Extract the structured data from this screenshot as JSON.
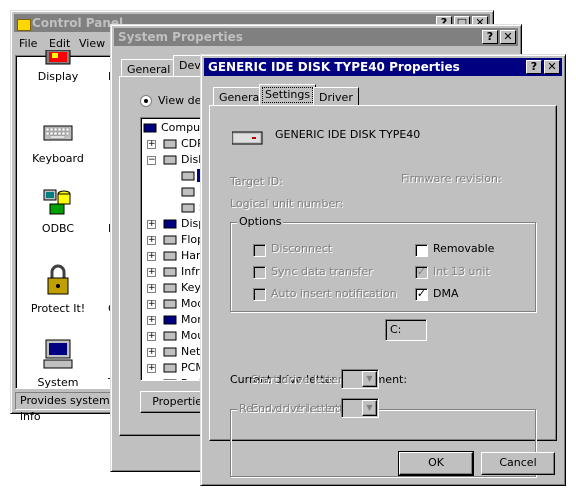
{
  "control_panel": {
    "title": "Control Panel",
    "menu": [
      "File",
      "Edit",
      "View"
    ],
    "icons": [
      {
        "label": "Display",
        "icon": "display-icon"
      },
      {
        "label": "Keyboard",
        "icon": "keyboard-icon"
      },
      {
        "label": "ODBC",
        "icon": "odbc-icon"
      },
      {
        "label": "Protect It!",
        "icon": "protect-it-icon"
      },
      {
        "label": "System",
        "icon": "system-icon"
      }
    ],
    "partial_column": [
      "I",
      "F",
      "C",
      "T"
    ],
    "status": "Provides system info"
  },
  "system_properties": {
    "title": "System Properties",
    "tabs": [
      "General",
      "Devi"
    ],
    "radio_label": "View dev",
    "tree": [
      {
        "label": "Compute",
        "expand": "",
        "icon": "computer-icon"
      },
      {
        "label": "CDR",
        "expand": "+",
        "icon": "cdrom-icon"
      },
      {
        "label": "Disk",
        "expand": "−",
        "icon": "disk-drive-icon"
      },
      {
        "label": "",
        "expand": "",
        "icon": "disk-drive-icon",
        "selected": true
      },
      {
        "label": "I",
        "expand": "",
        "icon": "disk-drive-icon"
      },
      {
        "label": "S",
        "expand": "",
        "icon": "disk-drive-icon"
      },
      {
        "label": "Disp",
        "expand": "+",
        "icon": "display-adapter-icon"
      },
      {
        "label": "Flop",
        "expand": "+",
        "icon": "floppy-icon"
      },
      {
        "label": "Hard",
        "expand": "+",
        "icon": "hard-disk-controller-icon"
      },
      {
        "label": "Infra",
        "expand": "+",
        "icon": "infrared-icon"
      },
      {
        "label": "Keyb",
        "expand": "+",
        "icon": "keyboard-icon"
      },
      {
        "label": "Mod",
        "expand": "+",
        "icon": "modem-icon"
      },
      {
        "label": "Mon",
        "expand": "+",
        "icon": "monitor-icon"
      },
      {
        "label": "Mou",
        "expand": "+",
        "icon": "mouse-icon"
      },
      {
        "label": "Netv",
        "expand": "+",
        "icon": "network-icon"
      },
      {
        "label": "PCM",
        "expand": "+",
        "icon": "pcmcia-icon"
      },
      {
        "label": "Port",
        "expand": "+",
        "icon": "port-icon"
      }
    ],
    "properties_button": "Properties"
  },
  "disk_dialog": {
    "title": "GENERIC IDE  DISK TYPE40 Properties",
    "tabs": [
      "General",
      "Settings",
      "Driver"
    ],
    "active_tab": "Settings",
    "device_name": "GENERIC IDE  DISK TYPE40",
    "target_id_label": "Target ID:",
    "firmware_label": "Firmware revision:",
    "lun_label": "Logical unit number:",
    "options_label": "Options",
    "options": {
      "disconnect": {
        "label": "Disconnect",
        "checked": false,
        "enabled": false
      },
      "removable": {
        "label": "Removable",
        "checked": false,
        "enabled": true
      },
      "sync": {
        "label": "Sync data transfer",
        "checked": false,
        "enabled": false
      },
      "int13": {
        "label": "Int 13 unit",
        "checked": true,
        "enabled": false
      },
      "auto_insert": {
        "label": "Auto insert notification",
        "checked": false,
        "enabled": false
      },
      "dma": {
        "label": "DMA",
        "checked": true,
        "enabled": true
      }
    },
    "current_drive_label": "Current drive letter assignment:",
    "current_drive_value": "C:",
    "reserved_label": "Reserved drive letters",
    "start_label": "Start drive letter:",
    "end_label": "End drive letter:",
    "ok_label": "OK",
    "cancel_label": "Cancel",
    "help_glyph": "?",
    "close_glyph": "✕",
    "check_glyph": "✓"
  }
}
